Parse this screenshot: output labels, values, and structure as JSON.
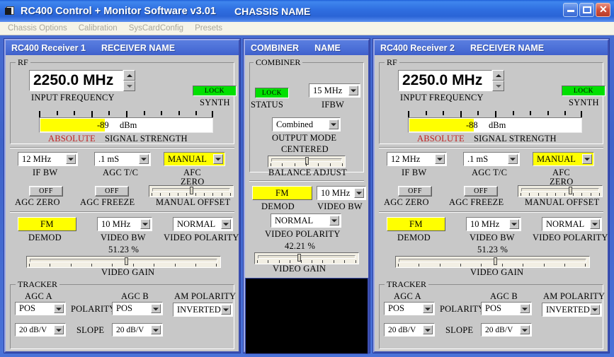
{
  "window": {
    "title": "RC400 Control + Monitor Software v3.01",
    "chassis_name": "CHASSIS NAME",
    "minimize_label": "_",
    "maximize_label": "□",
    "close_label": "✕",
    "accent_titlebar": "#2f6ee0",
    "panel_face": "#c8c8c8"
  },
  "menubar": {
    "items": [
      {
        "label": "Chassis Options"
      },
      {
        "label": "Calibration"
      },
      {
        "label": "SysCardConfig"
      },
      {
        "label": "Presets"
      }
    ]
  },
  "receiver1": {
    "header_left": "RC400 Receiver 1",
    "header_right": "RECEIVER NAME",
    "rf_group_label": "RF",
    "frequency_value": "2250.0 MHz",
    "frequency_caption": "INPUT FREQUENCY",
    "spin_up_icon": "triangle-up-icon",
    "spin_down_icon": "triangle-down-icon",
    "lock_label": "LOCK",
    "lock_color": "#00e000",
    "synth_caption": "SYNTH",
    "signal_value": "-89",
    "signal_units": "dBm",
    "signal_fill_pct": 38,
    "signal_mode": "ABSOLUTE",
    "signal_caption": "SIGNAL STRENGTH",
    "if_bw_value": "12 MHz",
    "if_bw_caption": "IF BW",
    "agc_tc_value": ".1 mS",
    "agc_tc_caption": "AGC T/C",
    "afc_value": "MANUAL",
    "afc_caption_1": "AFC",
    "afc_caption_2": "ZERO",
    "agc_zero_btn": "OFF",
    "agc_zero_caption": "AGC ZERO",
    "agc_freeze_btn": "OFF",
    "agc_freeze_caption": "AGC FREEZE",
    "manual_offset_caption": "MANUAL OFFSET",
    "manual_offset_pct": 50,
    "demod_value": "FM",
    "demod_caption": "DEMOD",
    "video_bw_value": "10 MHz",
    "video_bw_caption": "VIDEO BW",
    "video_polarity_value": "NORMAL",
    "video_polarity_caption": "VIDEO POLARITY",
    "video_gain_pct_text": "51.23  %",
    "video_gain_pct": 51.23,
    "video_gain_caption": "VIDEO GAIN",
    "tracker_group_label": "TRACKER",
    "agc_a_caption": "AGC A",
    "agc_b_caption": "AGC B",
    "polarity_caption": "POLARITY",
    "slope_caption": "SLOPE",
    "am_polarity_caption": "AM POLARITY",
    "agc_a_polarity": "POS",
    "agc_b_polarity": "POS",
    "agc_a_slope": "20 dB/V",
    "agc_b_slope": "20 dB/V",
    "am_polarity_value": "INVERTED"
  },
  "combiner": {
    "header_left": "COMBINER",
    "header_right": "NAME",
    "group_label": "COMBINER",
    "lock_label": "LOCK",
    "status_caption": "STATUS",
    "ifbw_value": "15 MHz",
    "ifbw_caption": "IFBW",
    "output_mode_value": "Combined",
    "output_mode_caption": "OUTPUT MODE",
    "balance_state": "CENTERED",
    "balance_caption": "BALANCE ADJUST",
    "balance_pct": 50,
    "demod_value": "FM",
    "demod_caption": "DEMOD",
    "video_bw_value": "10 MHz",
    "video_bw_caption": "VIDEO BW",
    "video_polarity_value": "NORMAL",
    "video_polarity_caption": "VIDEO POLARITY",
    "video_gain_pct_text": "42.21  %",
    "video_gain_pct": 42.21,
    "video_gain_caption": "VIDEO GAIN"
  },
  "receiver2": {
    "header_left": "RC400 Receiver  2",
    "header_right": "RECEIVER NAME",
    "rf_group_label": "RF",
    "frequency_value": "2250.0 MHz",
    "frequency_caption": "INPUT FREQUENCY",
    "lock_label": "LOCK",
    "synth_caption": "SYNTH",
    "signal_value": "-88",
    "signal_units": "dBm",
    "signal_fill_pct": 38,
    "signal_mode": "ABSOLUTE",
    "signal_caption": "SIGNAL STRENGTH",
    "if_bw_value": "12 MHz",
    "if_bw_caption": "IF BW",
    "agc_tc_value": ".1 mS",
    "agc_tc_caption": "AGC T/C",
    "afc_value": "MANUAL",
    "afc_caption_1": "AFC",
    "afc_caption_2": "ZERO",
    "agc_zero_btn": "OFF",
    "agc_zero_caption": "AGC ZERO",
    "agc_freeze_btn": "OFF",
    "agc_freeze_caption": "AGC FREEZE",
    "manual_offset_caption": "MANUAL OFFSET",
    "manual_offset_pct": 62,
    "demod_value": "FM",
    "demod_caption": "DEMOD",
    "video_bw_value": "10 MHz",
    "video_bw_caption": "VIDEO BW",
    "video_polarity_value": "NORMAL",
    "video_polarity_caption": "VIDEO POLARITY",
    "video_gain_pct_text": "51.23  %",
    "video_gain_pct": 51.23,
    "video_gain_caption": "VIDEO GAIN",
    "tracker_group_label": "TRACKER",
    "agc_a_caption": "AGC A",
    "agc_b_caption": "AGC B",
    "polarity_caption": "POLARITY",
    "slope_caption": "SLOPE",
    "am_polarity_caption": "AM POLARITY",
    "agc_a_polarity": "POS",
    "agc_b_polarity": "POS",
    "agc_a_slope": "20 dB/V",
    "agc_b_slope": "20 dB/V",
    "am_polarity_value": "INVERTED"
  }
}
